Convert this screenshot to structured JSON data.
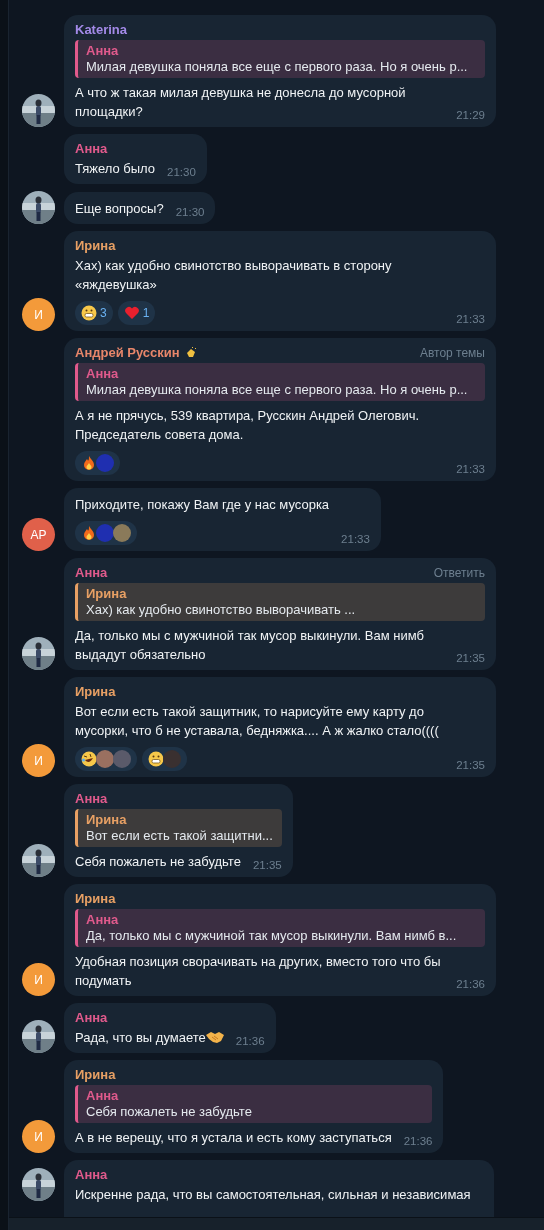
{
  "messages": [
    {
      "author": "Katerina",
      "color": "#a38ae8",
      "reply": {
        "author": "Анна",
        "color": "#e05a8c",
        "text": "Милая девушка поняла все еще с первого раза. Но я очень р..."
      },
      "text": "А что ж такая милая девушка не донесла до  мусорной площадки?",
      "time": "21:29"
    },
    {
      "author": "Анна",
      "color": "#e05a8c",
      "text": "Тяжело было",
      "time": "21:30"
    },
    {
      "text": "Еще вопросы?",
      "time": "21:30"
    },
    {
      "author": "Ирина",
      "color": "#e8a064",
      "text": "Хах) как удобно свинотство выворачивать в сторону «яждевушка»",
      "time": "21:33",
      "reactions": [
        {
          "kind": "grin",
          "count": "3"
        },
        {
          "kind": "heart",
          "count": "1"
        }
      ],
      "avatar": {
        "kind": "initials",
        "text": "И",
        "color": "#f39a3a"
      }
    },
    {
      "author": "Андрей Русскин",
      "color": "#e8866a",
      "name_icon": true,
      "badge": "Автор темы",
      "reply": {
        "author": "Анна",
        "color": "#e05a8c",
        "text": "Милая девушка поняла все еще с первого раза. Но я очень р..."
      },
      "text": "А я  не прячусь, 539 квартира, Русскин Андрей Олегович. Председатель совета дома.",
      "time": "21:33",
      "reactions": [
        {
          "kind": "fire",
          "avatars": [
            {
              "color": "#1f2fb0"
            }
          ]
        }
      ]
    },
    {
      "text": "Приходите, покажу Вам где у нас мусорка",
      "time": "21:33",
      "reactions": [
        {
          "kind": "fire",
          "avatars": [
            {
              "color": "#1f2fb0"
            },
            {
              "color": "#8a7a5a"
            }
          ]
        }
      ],
      "avatar": {
        "kind": "initials",
        "text": "АР",
        "color": "#e0604a"
      }
    },
    {
      "author": "Анна",
      "color": "#e05a8c",
      "badge": "Ответить",
      "reply": {
        "author": "Ирина",
        "color": "#e8a064",
        "text": "Хах) как удобно свинотство выворачивать ..."
      },
      "text": "Да, только мы с мужчиной так мусор выкинули. Вам нимб выдадут обязательно",
      "time": "21:35"
    },
    {
      "author": "Ирина",
      "color": "#e8a064",
      "text": "Вот если есть такой защитник, то нарисуйте ему карту до мусорки, что б не уставала, бедняжка.... А ж жалко стало((((",
      "time": "21:35",
      "reactions": [
        {
          "kind": "rofl",
          "avatars": [
            {
              "color": "#9a7060"
            },
            {
              "color": "#5a5a6a"
            }
          ]
        },
        {
          "kind": "grin",
          "avatars": [
            {
              "color": "#3a3030"
            }
          ]
        }
      ],
      "avatar": {
        "kind": "initials",
        "text": "И",
        "color": "#f39a3a"
      }
    },
    {
      "author": "Анна",
      "color": "#e05a8c",
      "reply": {
        "author": "Ирина",
        "color": "#e8a064",
        "text": "Вот если есть такой защитни..."
      },
      "text": "Себя пожалеть не забудьте",
      "time": "21:35"
    },
    {
      "author": "Ирина",
      "color": "#e8a064",
      "reply": {
        "author": "Анна",
        "color": "#e05a8c",
        "text": "Да, только мы с мужчиной так мусор выкинули.  Вам нимб в..."
      },
      "text": "Удобная позиция сворачивать на других, вместо того что бы подумать",
      "time": "21:36",
      "avatar": {
        "kind": "initials",
        "text": "И",
        "color": "#f39a3a"
      }
    },
    {
      "author": "Анна",
      "color": "#e05a8c",
      "text": "Рада, что вы думаете",
      "end_icon": true,
      "time": "21:36"
    },
    {
      "author": "Ирина",
      "color": "#e8a064",
      "reply": {
        "author": "Анна",
        "color": "#e05a8c",
        "text": "Себя пожалеть не забудьте"
      },
      "text": "А в не верещу, что я устала и есть кому заступаться",
      "time": "21:36",
      "avatar": {
        "kind": "initials",
        "text": "И",
        "color": "#f39a3a"
      }
    },
    {
      "author": "Анна",
      "color": "#e05a8c",
      "text": "Искренне рада, что вы самостоятельная, сильная и независимая",
      "cut": true
    }
  ]
}
